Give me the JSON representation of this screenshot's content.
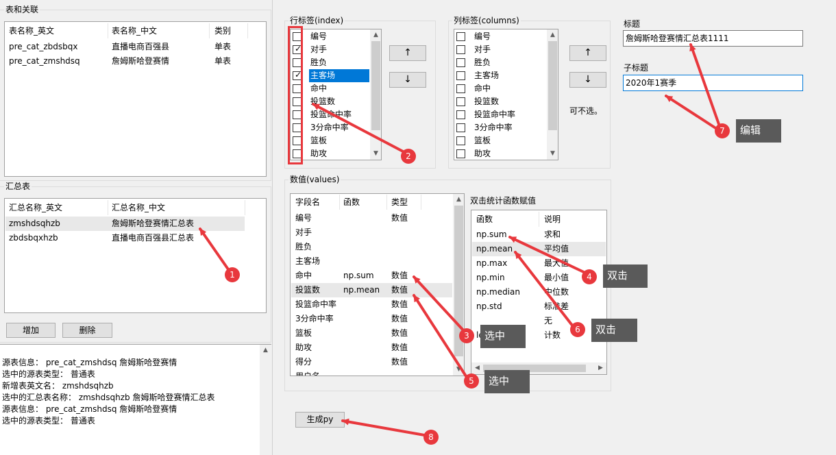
{
  "left": {
    "table_group_label": "表和关联",
    "table_headers": [
      "表名称_英文",
      "表名称_中文",
      "类别"
    ],
    "table_rows": [
      [
        "pre_cat_zbdsbqx",
        "直播电商百强县",
        "单表"
      ],
      [
        "pre_cat_zmshdsq",
        "詹姆斯哈登赛情",
        "单表"
      ]
    ],
    "summary_group_label": "汇总表",
    "summary_headers": [
      "汇总名称_英文",
      "汇总名称_中文"
    ],
    "summary_rows": [
      [
        "zmshdsqhzb",
        "詹姆斯哈登赛情汇总表"
      ],
      [
        "zbdsbqxhzb",
        "直播电商百强县汇总表"
      ]
    ],
    "add_button": "增加",
    "delete_button": "删除",
    "log_lines": [
      "源表信息： pre_cat_zmshdsq  詹姆斯哈登赛情",
      "选中的源表类型： 普通表",
      "新增表英文名： zmshdsqhzb",
      "选中的汇总表名称： zmshdsqhzb 詹姆斯哈登赛情汇总表",
      "源表信息： pre_cat_zmshdsq  詹姆斯哈登赛情",
      "选中的源表类型： 普通表"
    ]
  },
  "index": {
    "label": "行标签(index)",
    "items": [
      {
        "label": "编号",
        "checked": false,
        "selected": false
      },
      {
        "label": "对手",
        "checked": true,
        "selected": false
      },
      {
        "label": "胜负",
        "checked": false,
        "selected": false
      },
      {
        "label": "主客场",
        "checked": true,
        "selected": true
      },
      {
        "label": "命中",
        "checked": false,
        "selected": false
      },
      {
        "label": "投篮数",
        "checked": false,
        "selected": false
      },
      {
        "label": "投篮命中率",
        "checked": false,
        "selected": false
      },
      {
        "label": "3分命中率",
        "checked": false,
        "selected": false
      },
      {
        "label": "篮板",
        "checked": false,
        "selected": false
      },
      {
        "label": "助攻",
        "checked": false,
        "selected": false
      }
    ],
    "up": "↑",
    "down": "↓"
  },
  "columns": {
    "label": "列标签(columns)",
    "items": [
      {
        "label": "编号",
        "checked": false
      },
      {
        "label": "对手",
        "checked": false
      },
      {
        "label": "胜负",
        "checked": false
      },
      {
        "label": "主客场",
        "checked": false
      },
      {
        "label": "命中",
        "checked": false
      },
      {
        "label": "投篮数",
        "checked": false
      },
      {
        "label": "投篮命中率",
        "checked": false
      },
      {
        "label": "3分命中率",
        "checked": false
      },
      {
        "label": "篮板",
        "checked": false
      },
      {
        "label": "助攻",
        "checked": false
      }
    ],
    "up": "↑",
    "down": "↓",
    "optional_note": "可不选。"
  },
  "title": {
    "label": "标题",
    "value": "詹姆斯哈登赛情汇总表1111",
    "subtitle_label": "子标题",
    "subtitle_value": "2020年1赛季"
  },
  "values": {
    "label": "数值(values)",
    "headers": [
      "字段名",
      "函数",
      "类型"
    ],
    "rows": [
      [
        "编号",
        "",
        "数值"
      ],
      [
        "对手",
        "",
        ""
      ],
      [
        "胜负",
        "",
        ""
      ],
      [
        "主客场",
        "",
        ""
      ],
      [
        "命中",
        "np.sum",
        "数值"
      ],
      [
        "投篮数",
        "np.mean",
        "数值"
      ],
      [
        "投篮命中率",
        "",
        "数值"
      ],
      [
        "3分命中率",
        "",
        "数值"
      ],
      [
        "篮板",
        "",
        "数值"
      ],
      [
        "助攻",
        "",
        "数值"
      ],
      [
        "得分",
        "",
        "数值"
      ],
      [
        "用户名",
        "",
        ""
      ]
    ],
    "selected_row": 5
  },
  "funcs": {
    "label": "双击统计函数赋值",
    "headers": [
      "函数",
      "说明"
    ],
    "rows": [
      [
        "np.sum",
        "求和"
      ],
      [
        "np.mean",
        "平均值"
      ],
      [
        "np.max",
        "最大值"
      ],
      [
        "np.min",
        "最小值"
      ],
      [
        "np.median",
        "中位数"
      ],
      [
        "np.std",
        "标准差"
      ],
      [
        "",
        "无"
      ],
      [
        "len",
        "计数"
      ]
    ]
  },
  "generate_button": "生成py",
  "annotations": [
    {
      "num": "1",
      "text": ""
    },
    {
      "num": "2",
      "text": ""
    },
    {
      "num": "3",
      "text": "选中"
    },
    {
      "num": "4",
      "text": "双击"
    },
    {
      "num": "5",
      "text": "选中"
    },
    {
      "num": "6",
      "text": "双击"
    },
    {
      "num": "7",
      "text": "编辑"
    },
    {
      "num": "8",
      "text": ""
    }
  ],
  "colors": {
    "accent": "#0078d7",
    "annotation_red": "#e8383d",
    "tip_bg": "#5a5a5a"
  }
}
